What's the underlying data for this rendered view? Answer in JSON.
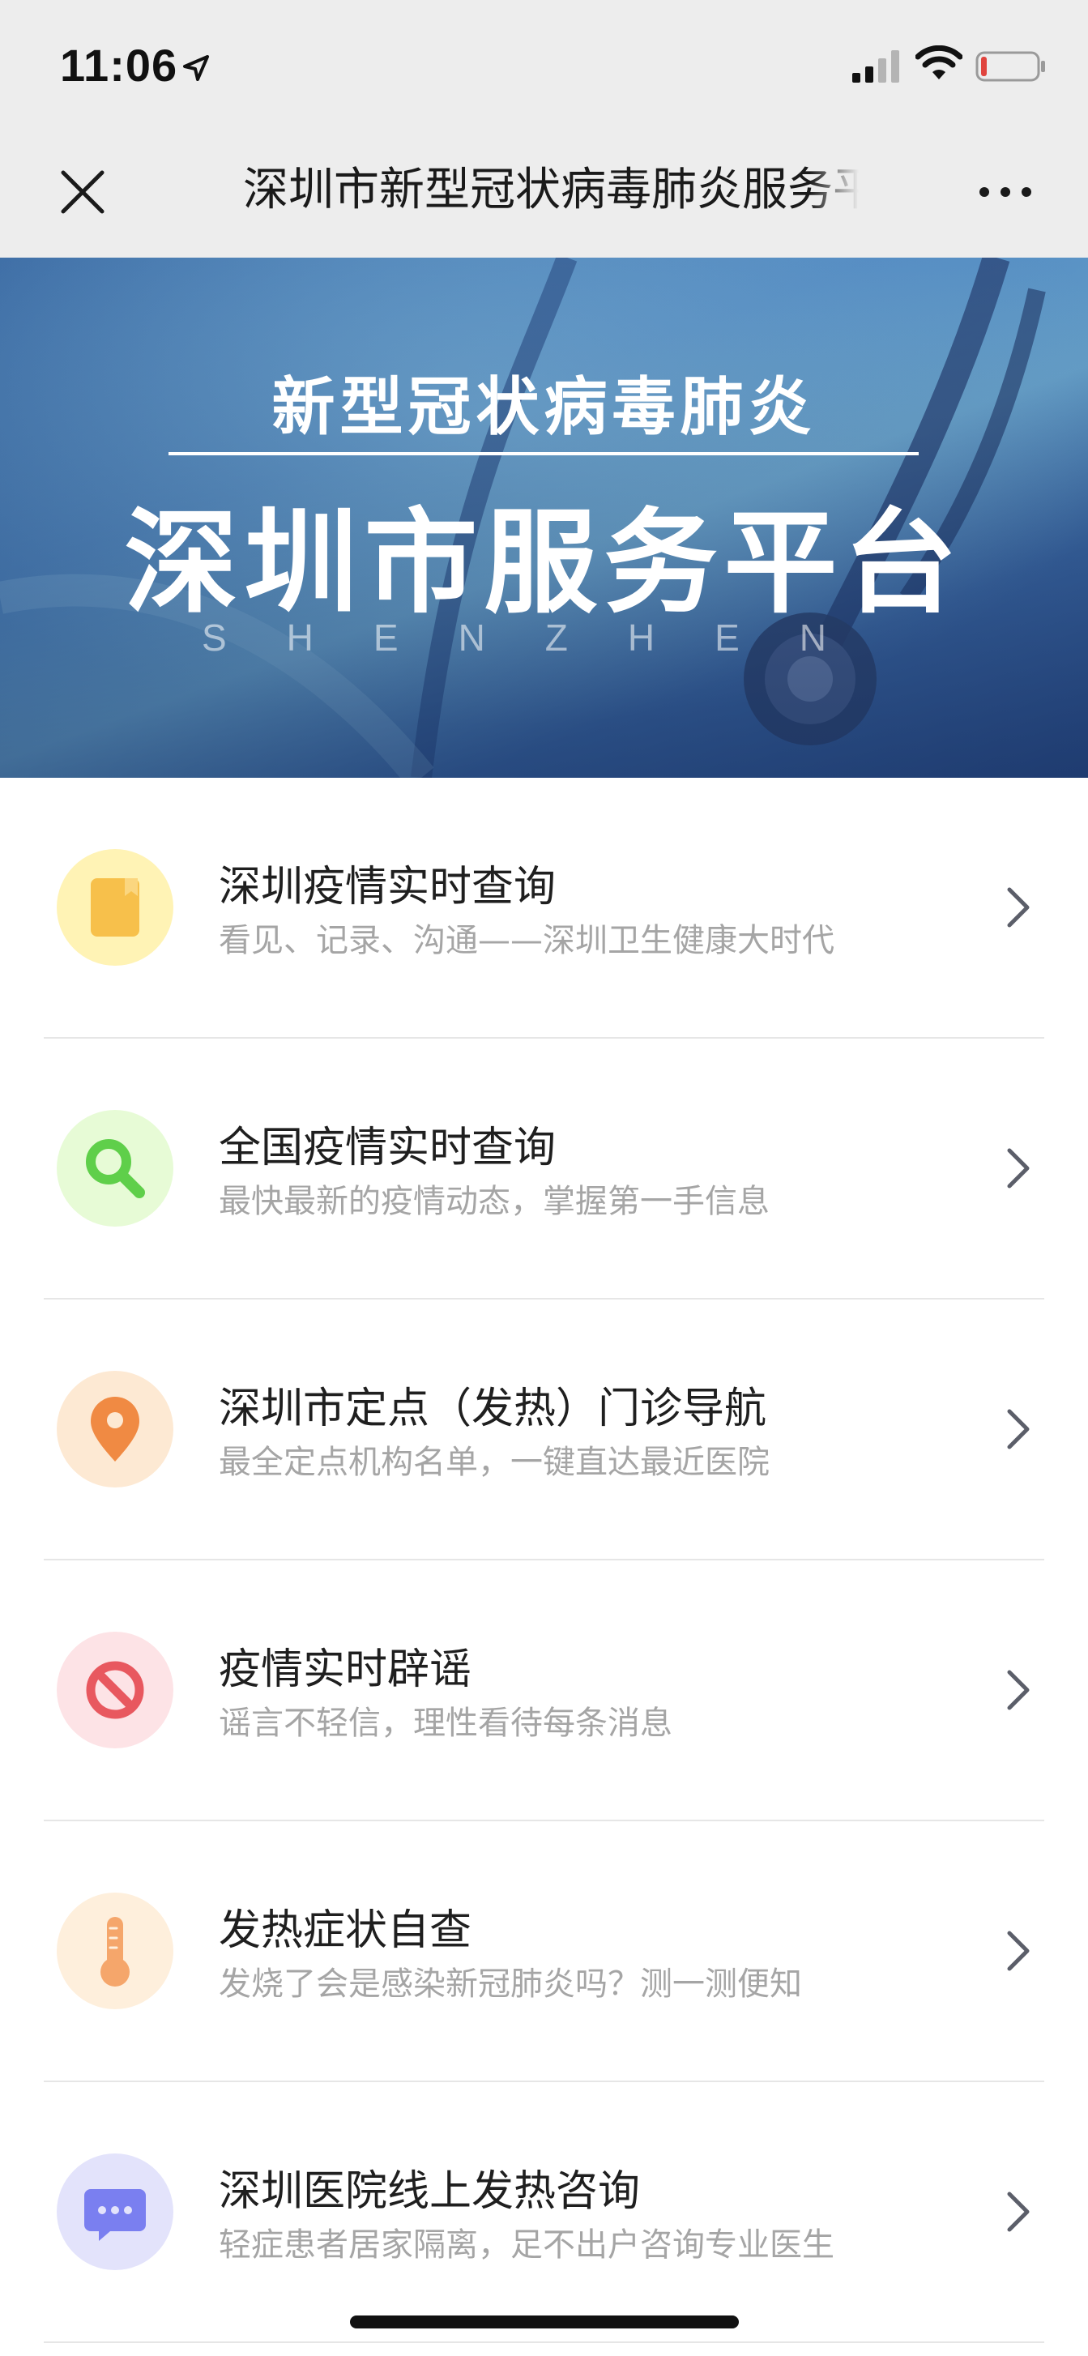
{
  "status_bar": {
    "time": "11:06",
    "icons": [
      "location-arrow-icon",
      "cellular-signal-icon",
      "wifi-icon",
      "battery-icon"
    ],
    "battery_color": "#e0443e"
  },
  "nav": {
    "title": "深圳市新型冠状病毒肺炎服务平台",
    "close_icon": "close-icon",
    "more_icon": "more-dots-icon"
  },
  "banner": {
    "subtitle": "新型冠状病毒肺炎",
    "title": "深圳市服务平台",
    "english": "SHENZHEN"
  },
  "menu": [
    {
      "title": "深圳疫情实时查询",
      "desc": "看见、记录、沟通——深圳卫生健康大时代",
      "icon": "book-icon",
      "bg": "#fff3b5",
      "fg": "#f7c04b"
    },
    {
      "title": "全国疫情实时查询",
      "desc": "最快最新的疫情动态，掌握第一手信息",
      "icon": "search-icon",
      "bg": "#e7fbd6",
      "fg": "#5fcf4a"
    },
    {
      "title": "深圳市定点（发热）门诊导航",
      "desc": "最全定点机构名单，一键直达最近医院",
      "icon": "map-pin-icon",
      "bg": "#fde9d3",
      "fg": "#f08a43"
    },
    {
      "title": "疫情实时辟谣",
      "desc": "谣言不轻信，理性看待每条消息",
      "icon": "no-entry-icon",
      "bg": "#fde3e6",
      "fg": "#e8585f"
    },
    {
      "title": "发热症状自查",
      "desc": "发烧了会是感染新冠肺炎吗？测一测便知",
      "icon": "thermometer-icon",
      "bg": "#feefdc",
      "fg": "#f5a66b"
    },
    {
      "title": "深圳医院线上发热咨询",
      "desc": "轻症患者居家隔离，足不出户咨询专业医生",
      "icon": "chat-bubble-icon",
      "bg": "#e3e3fb",
      "fg": "#7a7ff0"
    }
  ]
}
